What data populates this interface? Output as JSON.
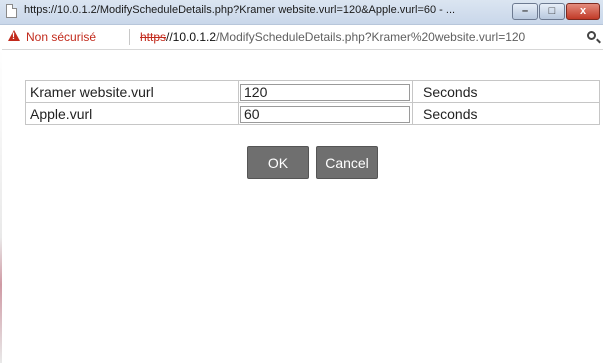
{
  "window": {
    "title": "https://10.0.1.2/ModifyScheduleDetails.php?Kramer website.vurl=120&Apple.vurl=60 - ...",
    "controls": {
      "minimize": "–",
      "maximize": "□",
      "close": "x"
    }
  },
  "addressbar": {
    "security_label": "Non sécurisé",
    "scheme": "https",
    "host": "//10.0.1.2",
    "path": "/ModifyScheduleDetails.php?Kramer%20website.vurl=120",
    "icons": {
      "warning": "warning-triangle-icon",
      "zoom": "magnifier-icon"
    }
  },
  "schedule": {
    "rows": [
      {
        "name": "Kramer website.vurl",
        "value": "120",
        "unit": "Seconds"
      },
      {
        "name": "Apple.vurl",
        "value": "60",
        "unit": "Seconds"
      }
    ]
  },
  "buttons": {
    "ok": "OK",
    "cancel": "Cancel"
  },
  "colors": {
    "button_bg": "#6f6f6f",
    "warning": "#c22a1c"
  }
}
